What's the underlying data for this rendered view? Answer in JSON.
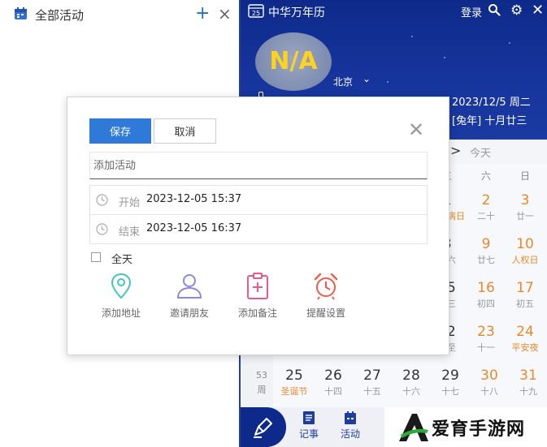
{
  "left_panel": {
    "title": "全部活动",
    "add_symbol": "+",
    "close_symbol": "×"
  },
  "calendar": {
    "app_name": "中华万年历",
    "logo_day": "25",
    "login": "登录",
    "weather_text": "N/A",
    "city": "北京",
    "date": "2023/12/5  周二",
    "lunar": "[兔年]  十月廿三",
    "nav_next": ">",
    "today_label": "今天",
    "weekday_headers": [
      "五",
      "六",
      "日"
    ],
    "rows": [
      [
        {
          "n": "1",
          "s": "艾滋病日",
          "we": false,
          "hol": true
        },
        {
          "n": "2",
          "s": "二十",
          "we": true,
          "hol": false
        },
        {
          "n": "3",
          "s": "廿一",
          "we": true,
          "hol": false
        }
      ],
      [
        {
          "n": "8",
          "s": "廿六",
          "we": false,
          "hol": false
        },
        {
          "n": "9",
          "s": "廿七",
          "we": true,
          "hol": false
        },
        {
          "n": "10",
          "s": "人权日",
          "we": true,
          "hol": true
        }
      ],
      [
        {
          "n": "15",
          "s": "初三",
          "we": false,
          "hol": false
        },
        {
          "n": "16",
          "s": "初四",
          "we": true,
          "hol": false
        },
        {
          "n": "17",
          "s": "初五",
          "we": true,
          "hol": false
        }
      ],
      [
        {
          "n": "22",
          "s": "冬至",
          "we": false,
          "hol": false
        },
        {
          "n": "23",
          "s": "十一",
          "we": true,
          "hol": false
        },
        {
          "n": "24",
          "s": "平安夜",
          "we": true,
          "hol": true
        }
      ]
    ],
    "last_row": [
      {
        "n": "25",
        "s": "圣诞节",
        "we": false,
        "hol": true
      },
      {
        "n": "26",
        "s": "十四",
        "we": false,
        "hol": false
      },
      {
        "n": "27",
        "s": "十五",
        "we": false,
        "hol": false
      },
      {
        "n": "28",
        "s": "十六",
        "we": false,
        "hol": false
      },
      {
        "n": "29",
        "s": "十七",
        "we": false,
        "hol": false
      },
      {
        "n": "30",
        "s": "十八",
        "we": true,
        "hol": false
      },
      {
        "n": "31",
        "s": "十九",
        "we": true,
        "hol": false
      }
    ],
    "week_number": "53",
    "week_label": "周",
    "bottom_tabs": [
      "记事",
      "活动"
    ]
  },
  "dialog": {
    "save_label": "保存",
    "cancel_label": "取消",
    "title_placeholder": "添加活动",
    "start_label": "开始",
    "start_value": "2023-12-05 15:37",
    "end_label": "结束",
    "end_value": "2023-12-05 16:37",
    "allday_label": "全天",
    "actions": [
      "添加地址",
      "邀请朋友",
      "添加备注",
      "提醒设置"
    ]
  },
  "watermark": {
    "text": "爱育手游网"
  },
  "colors": {
    "accent_blue": "#2f79d8",
    "calendar_navy": "#0d2a8a",
    "weekend_orange": "#e8892b",
    "location_teal": "#3ec6c0",
    "friend_purple": "#8a8ad8",
    "note_pink": "#e85a8a",
    "alarm_red": "#ef5a4a"
  },
  "icons": [
    "calendar-icon",
    "plus-icon",
    "close-icon",
    "search-icon",
    "gear-icon",
    "chevron-down-icon",
    "clock-icon",
    "location-icon",
    "person-icon",
    "clipboard-plus-icon",
    "alarm-icon",
    "pen-icon",
    "notes-icon"
  ]
}
